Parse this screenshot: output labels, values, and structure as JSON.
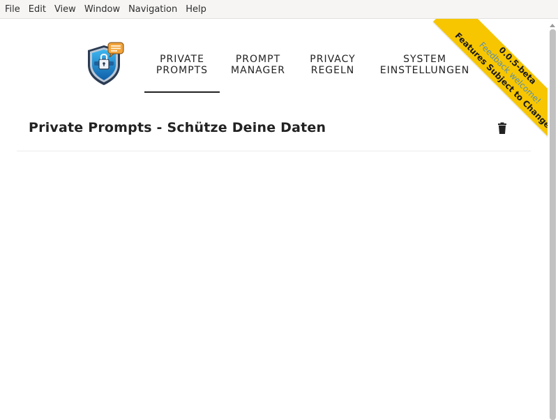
{
  "menubar": {
    "items": [
      "File",
      "Edit",
      "View",
      "Window",
      "Navigation",
      "Help"
    ]
  },
  "nav": {
    "tabs": [
      {
        "line1": "PRIVATE",
        "line2": "PROMPTS",
        "active": true
      },
      {
        "line1": "PROMPT",
        "line2": "MANAGER",
        "active": false
      },
      {
        "line1": "PRIVACY",
        "line2": "REGELN",
        "active": false
      },
      {
        "line1": "SYSTEM",
        "line2": "EINSTELLUNGEN",
        "active": false
      }
    ]
  },
  "page": {
    "title": "Private Prompts - Schütze Deine Daten"
  },
  "ribbon": {
    "version": "0.0.5-beta",
    "feedback": "Feedback welcome!",
    "features": "Features Subject to Change"
  },
  "colors": {
    "ribbon": "#f7c600",
    "feedback_text": "#5a8fb0",
    "text": "#222222",
    "menubar_bg": "#f6f5f4"
  },
  "icons": {
    "logo": "shield-lock-chat-icon",
    "delete": "trash-icon"
  }
}
